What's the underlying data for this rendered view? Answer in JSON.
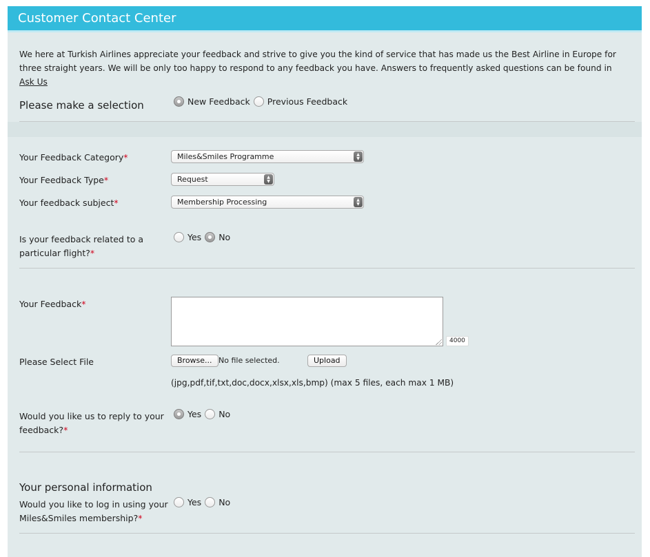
{
  "header": {
    "title": "Customer Contact Center"
  },
  "intro": {
    "text": "We here at Turkish Airlines appreciate your feedback and strive to give you the kind of service that has made us the Best Airline in Europe for three straight years. We will be only too happy to respond to any feedback you have. Answers to frequently asked questions can be found in ",
    "link": "Ask Us"
  },
  "selection": {
    "label": "Please make a selection",
    "options": [
      {
        "label": "New Feedback",
        "checked": true
      },
      {
        "label": "Previous Feedback",
        "checked": false
      }
    ]
  },
  "category": {
    "label": "Your Feedback Category",
    "value": "Miles&Smiles Programme"
  },
  "type": {
    "label": "Your Feedback Type",
    "value": "Request"
  },
  "subject": {
    "label": "Your feedback subject",
    "value": "Membership Processing"
  },
  "flight": {
    "label_line1": "Is your feedback related to a",
    "label_line2": "particular flight?",
    "yes": "Yes",
    "no": "No",
    "selected": "no"
  },
  "feedback": {
    "label": "Your Feedback",
    "value": "",
    "counter": "4000"
  },
  "file": {
    "label": "Please Select File",
    "browse": "Browse...",
    "status": "No file selected.",
    "upload": "Upload",
    "hint": "(jpg,pdf,tif,txt,doc,docx,xlsx,xls,bmp) (max 5 files, each max 1 MB)"
  },
  "reply": {
    "label_line1": "Would you like us to reply to your",
    "label_line2": "feedback?",
    "yes": "Yes",
    "no": "No",
    "selected": "yes"
  },
  "personal": {
    "title": "Your personal information",
    "label_line1": "Would you like to log in using your",
    "label_line2": "Miles&Smiles membership?",
    "yes": "Yes",
    "no": "No",
    "selected": "none"
  },
  "required_mark": "*",
  "colors": {
    "header": "#33bbdc",
    "panel": "#e1eaeb",
    "required": "#d0021b"
  }
}
